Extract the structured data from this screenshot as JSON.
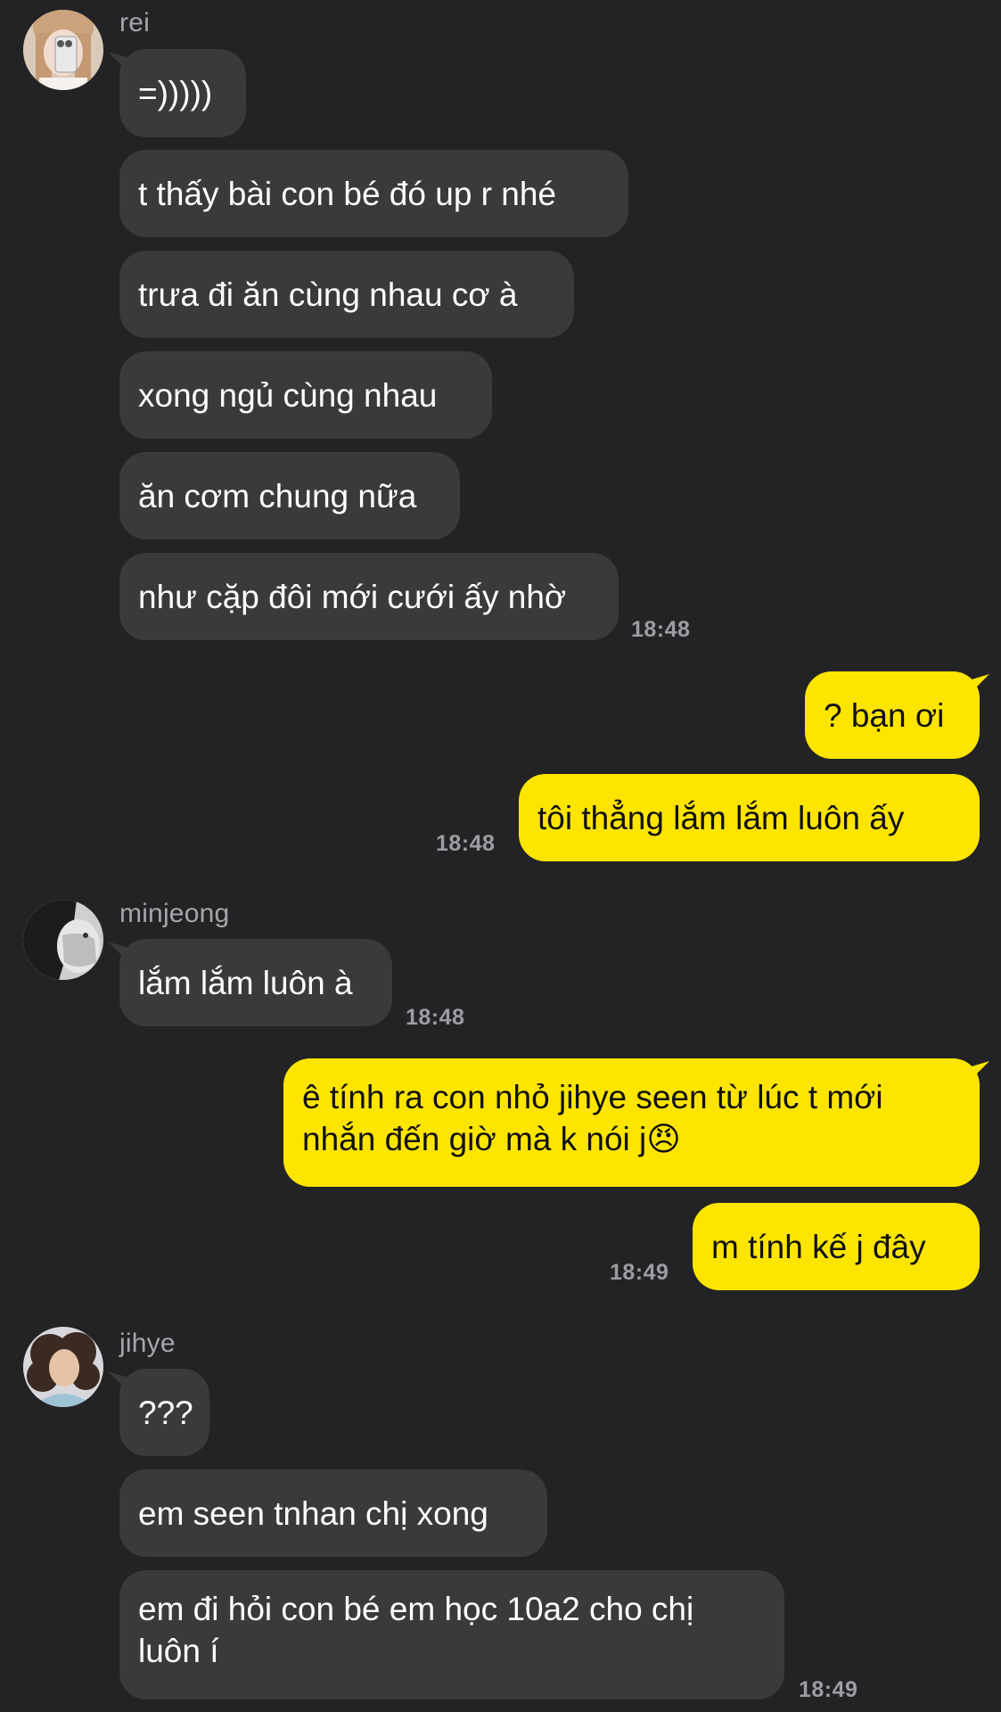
{
  "groups": [
    {
      "sender": "rei",
      "messages": [
        "=)))))",
        "t thấy bài con bé đó up r nhé",
        "trưa đi ăn cùng nhau cơ à",
        "xong ngủ cùng nhau",
        "ăn cơm chung nữa",
        "như cặp đôi mới cưới ấy nhờ"
      ],
      "time": "18:48"
    },
    {
      "sender": "me",
      "messages": [
        "? bạn ơi",
        "tôi thẳng lắm lắm luôn ấy"
      ],
      "time": "18:48"
    },
    {
      "sender": "minjeong",
      "messages": [
        "lắm lắm luôn à"
      ],
      "time": "18:48"
    },
    {
      "sender": "me",
      "messages": [
        "ê tính ra con nhỏ jihye seen từ lúc t mới nhắn đến giờ mà k nói j",
        "m tính kế j đây"
      ],
      "emoji": "😠",
      "time": "18:49"
    },
    {
      "sender": "jihye",
      "messages": [
        "???",
        "em seen tnhan chị xong",
        "em đi hỏi con bé em học 10a2 cho chị luôn í"
      ],
      "time": "18:49"
    }
  ],
  "colors": {
    "background": "#232325",
    "incoming_bubble": "#3a3a3c",
    "outgoing_bubble": "#fee500",
    "incoming_text": "#ffffff",
    "outgoing_text": "#111111",
    "meta_text": "#9d9da1"
  },
  "avatars": {
    "rei": "avatar-selfie-icon",
    "minjeong": "avatar-grayscale-portrait-icon",
    "jihye": "avatar-curly-hair-portrait-icon"
  }
}
